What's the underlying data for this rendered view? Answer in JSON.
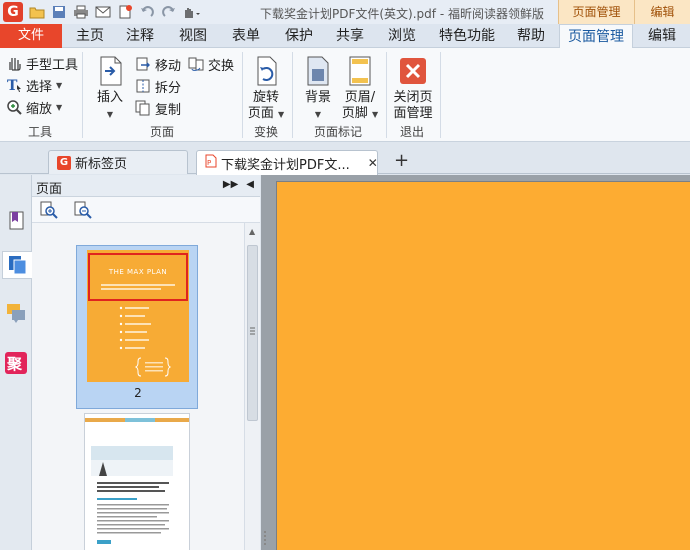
{
  "window": {
    "title": "下载奖金计划PDF文件(英文).pdf - 福昕阅读器领鲜版",
    "context_tabs": [
      "页面管理",
      "编辑"
    ]
  },
  "menu": {
    "file": "文件",
    "tabs": [
      "主页",
      "注释",
      "视图",
      "表单",
      "保护",
      "共享",
      "浏览",
      "特色功能",
      "帮助",
      "页面管理",
      "编辑"
    ],
    "active_tab": "页面管理"
  },
  "ribbon": {
    "tools": {
      "hand": "手型工具",
      "select": "选择",
      "zoom": "缩放",
      "group": "工具"
    },
    "pages": {
      "insert": "插入",
      "move": "移动",
      "swap": "交换",
      "split": "拆分",
      "copy": "复制",
      "group": "页面"
    },
    "transform": {
      "rotate_line1": "旋转",
      "rotate_line2": "页面",
      "group": "变换"
    },
    "marks": {
      "background": "背景",
      "header_line1": "页眉/",
      "header_line2": "页脚",
      "group": "页面标记"
    },
    "exit": {
      "close_line1": "关闭页",
      "close_line2": "面管理",
      "group": "退出"
    }
  },
  "tabs": {
    "new_tab": "新标签页",
    "doc_tab": "下载奖金计划PDF文...",
    "close_symbol": "✕",
    "add_symbol": "+"
  },
  "panel": {
    "title": "页面",
    "selected_page_number": "2"
  },
  "thumbnail": {
    "title": "THE MAX PLAN"
  },
  "colors": {
    "brand_red": "#e8462b",
    "page_orange": "#fdac32",
    "selection_blue": "#b9d4f3"
  }
}
